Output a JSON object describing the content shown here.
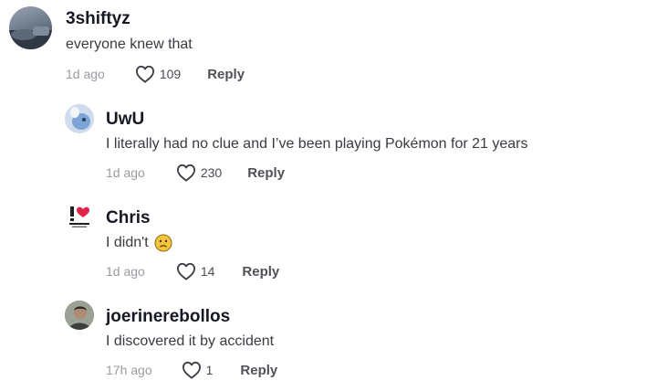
{
  "comments": [
    {
      "username": "3shiftyz",
      "text": "everyone knew that",
      "time": "1d ago",
      "likes": "109",
      "reply_label": "Reply",
      "avatar_icon": "avatar-photo-icon"
    },
    {
      "username": "UwU",
      "text": "I literally had no clue and I’ve been playing Pokémon for 21 years",
      "time": "1d ago",
      "likes": "230",
      "reply_label": "Reply",
      "avatar_icon": "avatar-cartoon-icon"
    },
    {
      "username": "Chris",
      "text": "I didn't",
      "emoji": "slightly-frowning-face-icon",
      "time": "1d ago",
      "likes": "14",
      "reply_label": "Reply",
      "avatar_icon": "avatar-i-heart-logo-icon"
    },
    {
      "username": "joerinerebollos",
      "text": "I discovered it by accident",
      "time": "17h ago",
      "likes": "1",
      "reply_label": "Reply",
      "avatar_icon": "avatar-photo-icon"
    }
  ],
  "colors": {
    "username": "#161823",
    "text": "#3a3b42",
    "meta": "#9a9ba1",
    "reply": "#505159",
    "heart_logo": "#e1254a"
  }
}
